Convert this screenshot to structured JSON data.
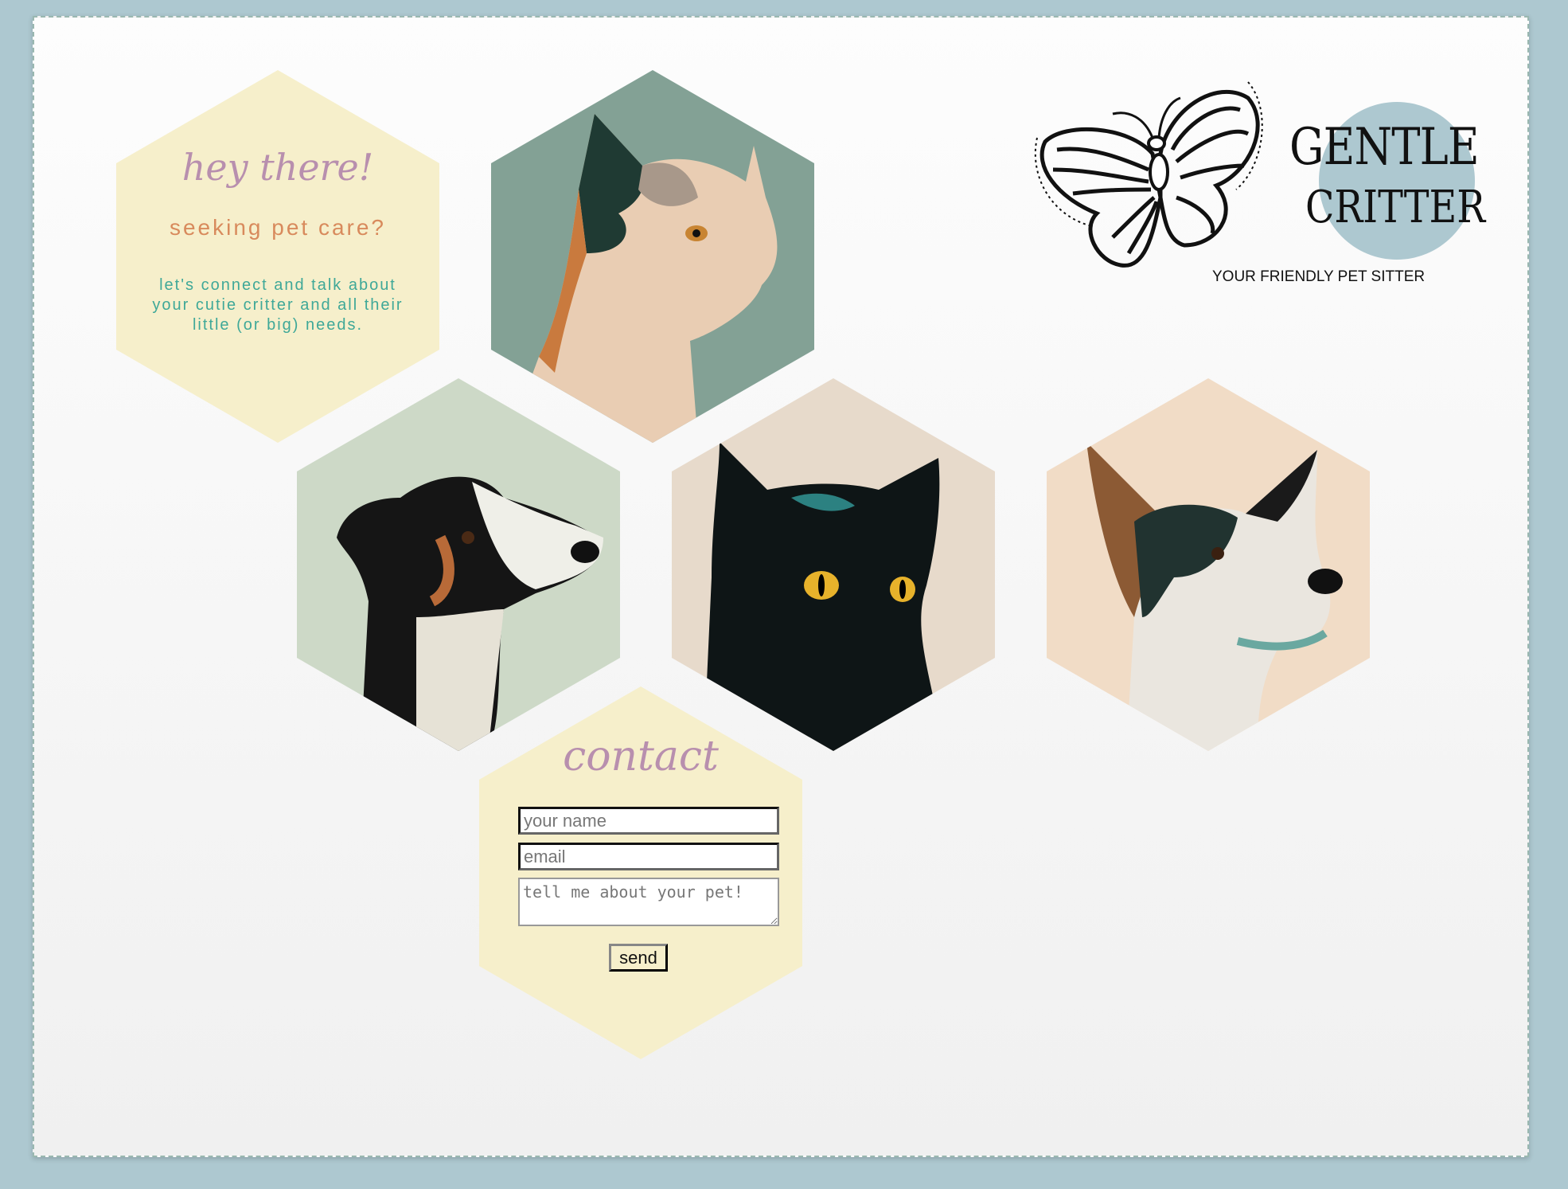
{
  "logo": {
    "line1": "GENTLE",
    "line2": "CRITTER",
    "tagline": "YOUR FRIENDLY PET SITTER"
  },
  "intro": {
    "title": "hey there!",
    "subtitle": "seeking pet care?",
    "body": "let's connect and talk about your cutie critter and all their little (or big) needs."
  },
  "contact": {
    "title": "contact",
    "name_placeholder": "your name",
    "email_placeholder": "email",
    "message_placeholder": "tell me about your pet!",
    "send_label": "send"
  },
  "colors": {
    "frame": "#adc8d0",
    "hex_yellow": "#f6efcb",
    "script_pink": "#b88fae",
    "orange": "#d88a5c",
    "teal": "#3fa898"
  }
}
